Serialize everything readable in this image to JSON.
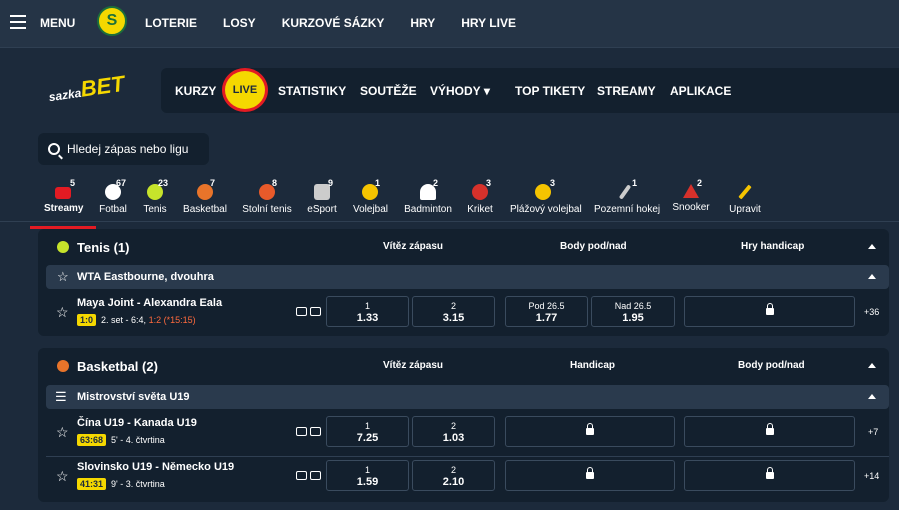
{
  "topbar": {
    "menu": "MENU",
    "logo": "S",
    "nav": [
      "LOTERIE",
      "LOSY",
      "KURZOVÉ SÁZKY",
      "HRY",
      "HRY LIVE"
    ]
  },
  "brand": {
    "sazka": "sazka",
    "bet": "BET"
  },
  "navbar": {
    "items": [
      "KURZY",
      "LIVE",
      "STATISTIKY",
      "SOUTĚŽE",
      "VÝHODY",
      "TOP TIKETY",
      "STREAMY",
      "APLIKACE"
    ]
  },
  "search": {
    "placeholder": "Hledej zápas nebo ligu"
  },
  "sports": [
    {
      "label": "Streamy",
      "count": "5",
      "color": "#e31b23"
    },
    {
      "label": "Fotbal",
      "count": "67",
      "color": "#ffffff"
    },
    {
      "label": "Tenis",
      "count": "23",
      "color": "#c6e32b"
    },
    {
      "label": "Basketbal",
      "count": "7",
      "color": "#e8742a"
    },
    {
      "label": "Stolní tenis",
      "count": "8",
      "color": "#e85a2a"
    },
    {
      "label": "eSport",
      "count": "9",
      "color": "#cccccc"
    },
    {
      "label": "Volejbal",
      "count": "1",
      "color": "#f5c400"
    },
    {
      "label": "Badminton",
      "count": "2",
      "color": "#ffffff"
    },
    {
      "label": "Kriket",
      "count": "3",
      "color": "#d6312b"
    },
    {
      "label": "Plážový volejbal",
      "count": "3",
      "color": "#f5c400"
    },
    {
      "label": "Pozemní hokej",
      "count": "1",
      "color": "#cccccc"
    },
    {
      "label": "Snooker",
      "count": "2",
      "color": "#d6312b"
    },
    {
      "label": "Upravit",
      "count": "",
      "color": "#f5c400"
    }
  ],
  "tenis": {
    "title": "Tenis (1)",
    "cols": [
      "Vítěz zápasu",
      "Body pod/nad",
      "Hry handicap"
    ],
    "league": "WTA Eastbourne, dvouhra",
    "match": {
      "name": "Maya Joint - Alexandra Eala",
      "score": "1:0",
      "status": "2. set - 6:4,",
      "live": "1:2 (*15:15)",
      "odds": [
        {
          "l": "1",
          "v": "1.33"
        },
        {
          "l": "2",
          "v": "3.15"
        },
        {
          "l": "Pod 26.5",
          "v": "1.77"
        },
        {
          "l": "Nad 26.5",
          "v": "1.95"
        }
      ],
      "more": "+36"
    }
  },
  "basket": {
    "title": "Basketbal (2)",
    "cols": [
      "Vítěz zápasu",
      "Handicap",
      "Body pod/nad"
    ],
    "league": "Mistrovství světa U19",
    "matches": [
      {
        "name": "Čína U19 - Kanada U19",
        "score": "63:68",
        "status": "5' - 4. čtvrtina",
        "odds": [
          {
            "l": "1",
            "v": "7.25"
          },
          {
            "l": "2",
            "v": "1.03"
          }
        ],
        "more": "+7"
      },
      {
        "name": "Slovinsko U19 - Německo U19",
        "score": "41:31",
        "status": "9' - 3. čtvrtina",
        "odds": [
          {
            "l": "1",
            "v": "1.59"
          },
          {
            "l": "2",
            "v": "2.10"
          }
        ],
        "more": "+14"
      }
    ]
  }
}
